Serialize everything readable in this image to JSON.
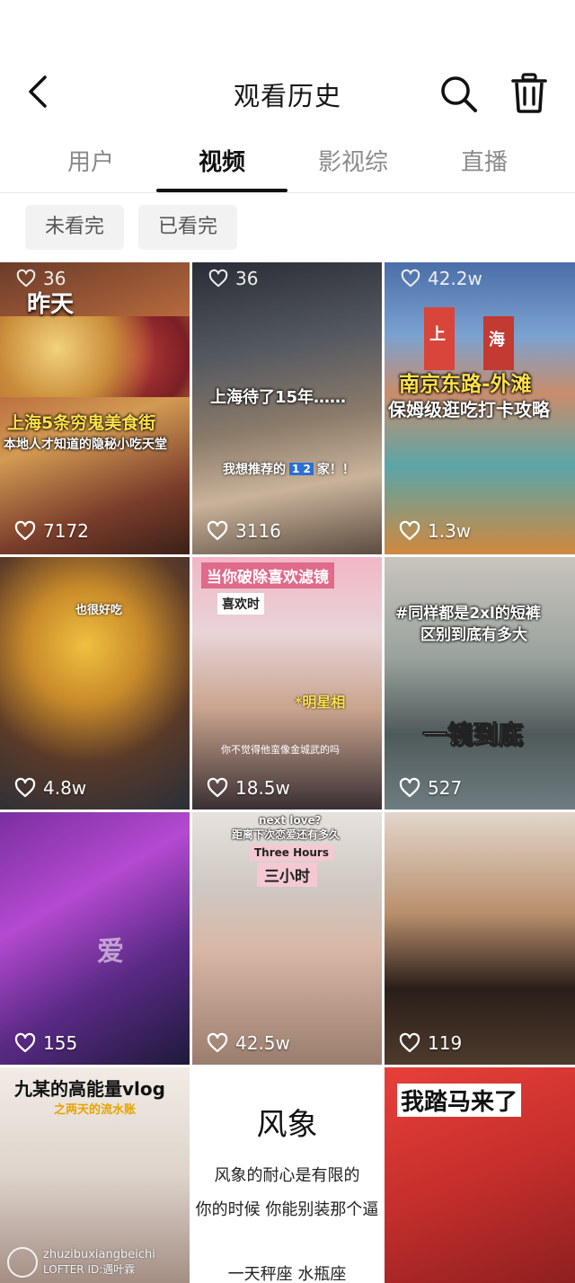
{
  "header": {
    "title": "观看历史"
  },
  "tabs": [
    {
      "label": "用户"
    },
    {
      "label": "视频"
    },
    {
      "label": "影视综"
    },
    {
      "label": "直播"
    }
  ],
  "filters": [
    {
      "label": "未看完"
    },
    {
      "label": "已看完"
    }
  ],
  "top_row": [
    {
      "likes": "36"
    },
    {
      "likes": "36"
    },
    {
      "likes": "42.2w"
    }
  ],
  "videos": [
    {
      "likes": "7172",
      "overlay1": "昨天",
      "overlay2": "上海5条穷鬼美食街",
      "overlay3": "本地人才知道的隐秘小吃天堂"
    },
    {
      "likes": "3116",
      "overlay1": "上海待了15年……",
      "overlay2": "我想推荐的",
      "overlay3": "1 2",
      "overlay4": "家！！"
    },
    {
      "likes": "1.3w",
      "overlay1": "南京东路-外滩",
      "overlay2": "保姆级逛吃打卡攻略",
      "overlay3": "上",
      "overlay4": "海"
    },
    {
      "likes": "4.8w",
      "overlay1": "也很好吃"
    },
    {
      "likes": "18.5w",
      "overlay1": "当你破除喜欢滤镜",
      "overlay2": "喜欢时",
      "overlay3": "*明星相",
      "overlay4": "你不觉得他蛮像金城武的吗"
    },
    {
      "likes": "527",
      "overlay1": "#同样都是2xl的短裤",
      "overlay2": "区别到底有多大",
      "overlay3": "一镜到底"
    },
    {
      "likes": "155",
      "overlay1": "爱"
    },
    {
      "likes": "42.5w",
      "overlay1": "next love?",
      "overlay2": "距离下次恋爱还有多久",
      "overlay3": "Three Hours",
      "overlay4": "三小时"
    },
    {
      "likes": "119"
    },
    {
      "overlay1": "九某的高能量vlog",
      "overlay2": "之两天的流水账"
    },
    {
      "overlay1": "风象",
      "overlay2": "风象的耐心是有限的",
      "overlay3": "你的时候 你能别装那个逼",
      "overlay4": "一天秤座 水瓶座"
    },
    {
      "overlay1": "我踏马来了"
    }
  ],
  "watermark": {
    "line1": "zhuzibuxiangbeichi",
    "line2": "LOFTER ID:遇叶霖"
  },
  "colors": {
    "active_tab": "#111111",
    "inactive_tab": "#8a8a8a",
    "chip_bg": "#f2f2f2",
    "accent_yellow": "#ffe14a",
    "accent_red": "#e23a3a"
  }
}
